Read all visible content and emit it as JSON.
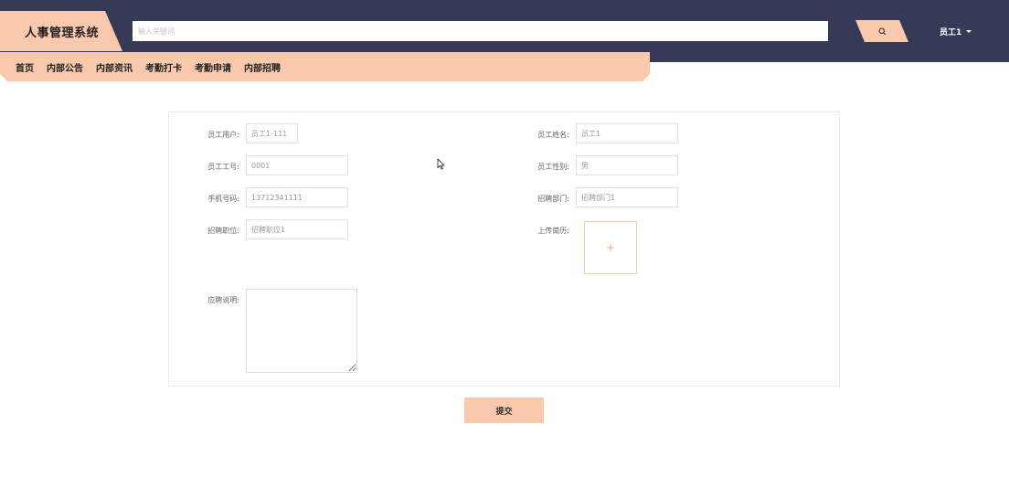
{
  "header": {
    "app_title": "人事管理系统",
    "search_placeholder": "输入关键词",
    "search_icon": "search-icon",
    "user_name": "员工1",
    "user_caret_icon": "caret-down-icon"
  },
  "nav": {
    "items": [
      {
        "label": "首页"
      },
      {
        "label": "内部公告"
      },
      {
        "label": "内部资讯"
      },
      {
        "label": "考勤打卡"
      },
      {
        "label": "考勤申请"
      },
      {
        "label": "内部招聘"
      }
    ]
  },
  "form": {
    "account": {
      "label": "员工用户:",
      "value": "员工1-111"
    },
    "name": {
      "label": "员工姓名:",
      "value": "员工1"
    },
    "employee_no": {
      "label": "员工工号:",
      "value": "0001"
    },
    "gender": {
      "label": "员工性别:",
      "value": "男"
    },
    "phone": {
      "label": "手机号码:",
      "value": "13712341111"
    },
    "department": {
      "label": "招聘部门:",
      "value": "招聘部门1"
    },
    "position": {
      "label": "招聘职位:",
      "value": "招聘职位1"
    },
    "resume": {
      "label": "上传简历:",
      "icon": "plus-icon"
    },
    "description": {
      "label": "应聘说明:",
      "value": ""
    },
    "submit_label": "提交"
  },
  "colors": {
    "header_bg": "#353a56",
    "accent": "#f9c9ad",
    "upload_border": "#f6c8ab"
  }
}
